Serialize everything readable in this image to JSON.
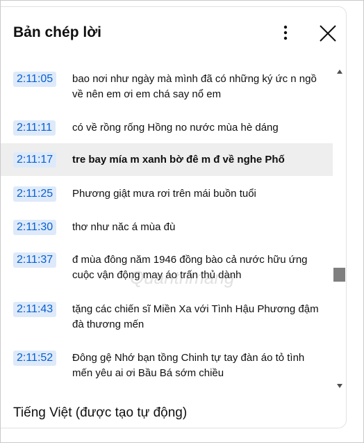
{
  "header": {
    "title": "Bản chép lời",
    "menu_icon": "more-vert-icon",
    "close_icon": "close-icon"
  },
  "segments": [
    {
      "time": "2:11:05",
      "text": "bao nơi như ngày mà mình đã có những ký ức n ngồ về nên em ơi em chá say nổ em"
    },
    {
      "time": "2:11:11",
      "text": "có về rồng rống Hồng no nước mùa hè dáng"
    },
    {
      "time": "2:11:17",
      "text": "tre bay mía m xanh bờ đê m đ về nghe Phố"
    },
    {
      "time": "2:11:25",
      "text": "Phương giật mưa rơi trên mái buồn tuổi"
    },
    {
      "time": "2:11:30",
      "text": "thơ như năc á mùa đù"
    },
    {
      "time": "2:11:37",
      "text": "đ mùa đông năm 1946 đồng bào cả nước hữu ứng cuộc vận động may áo trấn thủ dành"
    },
    {
      "time": "2:11:43",
      "text": "tặng các chiến sĩ Miền Xa với Tình Hậu Phương đậm đà thương mến"
    },
    {
      "time": "2:11:52",
      "text": "Đông gệ Nhớ bạn tồng Chinh tự tay đàn áo tỏ tình mến yêu ai ơi Bầu Bá sớm chiều"
    }
  ],
  "active_index": 2,
  "footer": {
    "language": "Tiếng Việt (được tạo tự động)"
  },
  "watermark": "Quantrimang",
  "colors": {
    "timestamp_bg": "#deeaf9",
    "timestamp_text": "#065fd4",
    "active_row_bg": "#eeeeee"
  }
}
